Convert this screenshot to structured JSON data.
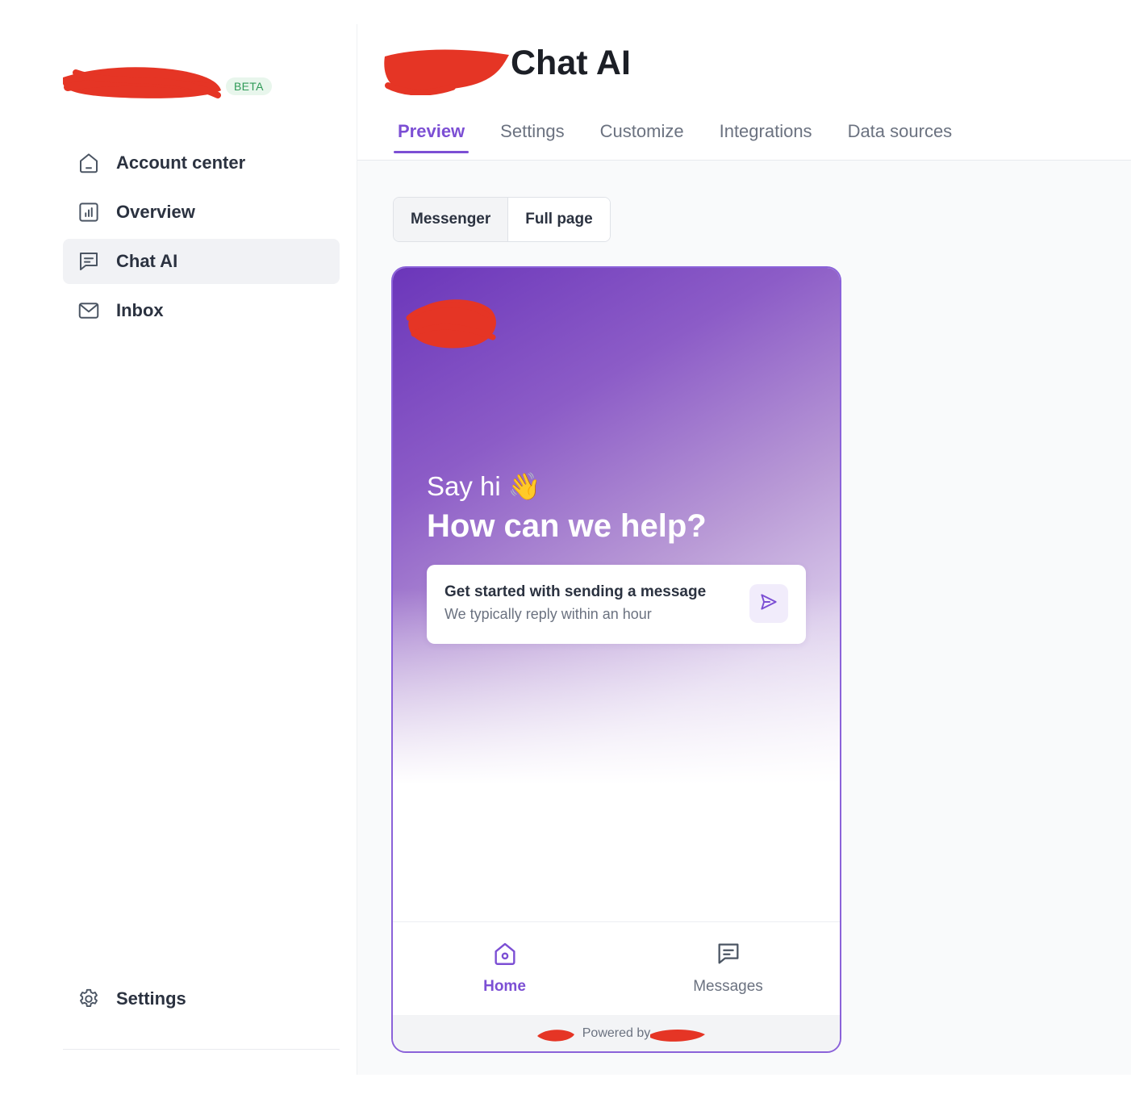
{
  "brand": {
    "badge": "BETA"
  },
  "sidebar": {
    "items": [
      {
        "label": "Account center",
        "icon": "home-icon",
        "active": false
      },
      {
        "label": "Overview",
        "icon": "chart-icon",
        "active": false
      },
      {
        "label": "Chat AI",
        "icon": "chat-icon",
        "active": true
      },
      {
        "label": "Inbox",
        "icon": "mail-icon",
        "active": false
      }
    ],
    "bottom": {
      "label": "Settings",
      "icon": "gear-icon"
    }
  },
  "header": {
    "title": "Chat AI",
    "tabs": [
      {
        "label": "Preview",
        "active": true
      },
      {
        "label": "Settings",
        "active": false
      },
      {
        "label": "Customize",
        "active": false
      },
      {
        "label": "Integrations",
        "active": false
      },
      {
        "label": "Data sources",
        "active": false
      }
    ]
  },
  "preview": {
    "modes": [
      {
        "label": "Messenger",
        "active": true
      },
      {
        "label": "Full page",
        "active": false
      }
    ],
    "widget": {
      "greeting": "Say hi 👋",
      "headline": "How can we help?",
      "card_title": "Get started with sending a message",
      "card_subtitle": "We typically reply within an hour",
      "nav": [
        {
          "label": "Home",
          "icon": "home-icon",
          "active": true
        },
        {
          "label": "Messages",
          "icon": "message-icon",
          "active": false
        }
      ],
      "powered_by": "Powered by"
    }
  },
  "colors": {
    "accent": "#7c4fd4",
    "widget_border": "#8b62d9",
    "beta_bg": "#e8f6ec",
    "beta_text": "#2f9a57",
    "redaction": "#e53525"
  }
}
